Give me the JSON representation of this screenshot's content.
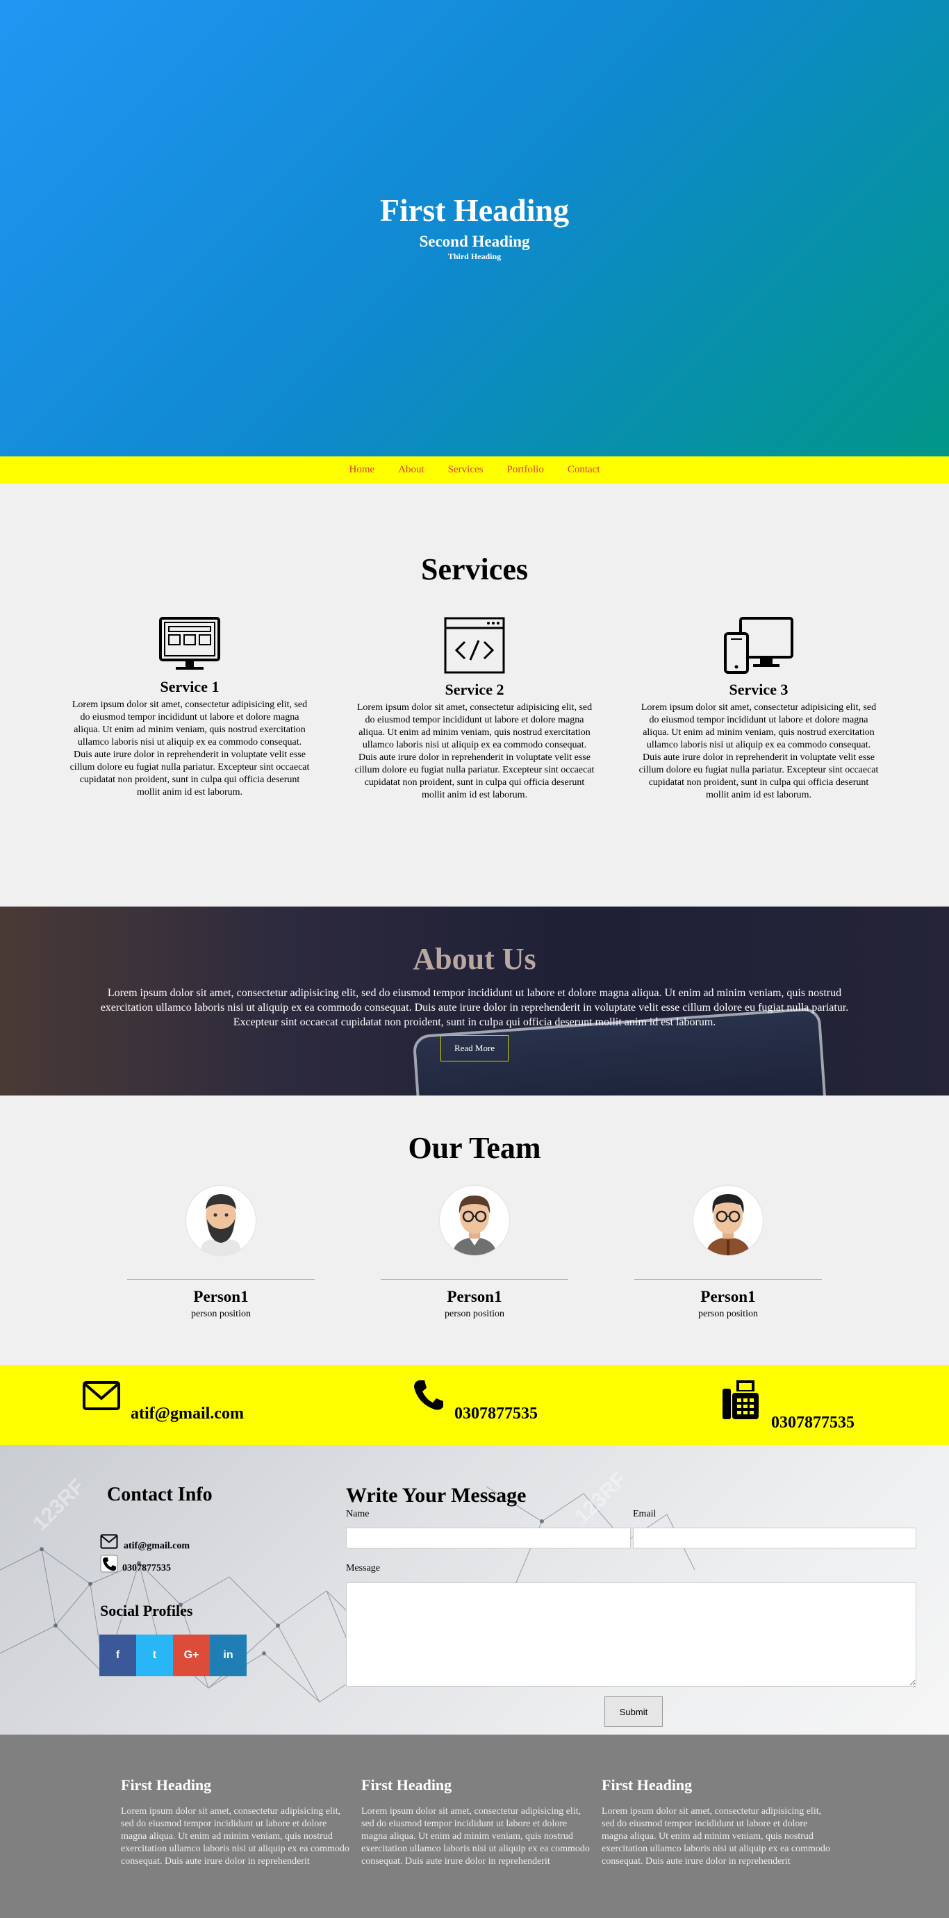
{
  "hero": {
    "heading1": "First Heading",
    "heading2": "Second Heading",
    "heading3": "Third Heading"
  },
  "nav": [
    "Home",
    "About",
    "Services",
    "Portfolio",
    "Contact"
  ],
  "services": {
    "title": "Services",
    "items": [
      {
        "title": "Service 1",
        "icon": "browser-window-icon",
        "text": "Lorem ipsum dolor sit amet, consectetur adipisicing elit, sed do eiusmod tempor incididunt ut labore et dolore magna aliqua. Ut enim ad minim veniam, quis nostrud exercitation ullamco laboris nisi ut aliquip ex ea commodo consequat. Duis aute irure dolor in reprehenderit in voluptate velit esse cillum dolore eu fugiat nulla pariatur. Excepteur sint occaecat cupidatat non proident, sunt in culpa qui officia deserunt mollit anim id est laborum."
      },
      {
        "title": "Service 2",
        "icon": "code-window-icon",
        "text": "Lorem ipsum dolor sit amet, consectetur adipisicing elit, sed do eiusmod tempor incididunt ut labore et dolore magna aliqua. Ut enim ad minim veniam, quis nostrud exercitation ullamco laboris nisi ut aliquip ex ea commodo consequat. Duis aute irure dolor in reprehenderit in voluptate velit esse cillum dolore eu fugiat nulla pariatur. Excepteur sint occaecat cupidatat non proident, sunt in culpa qui officia deserunt mollit anim id est laborum."
      },
      {
        "title": "Service 3",
        "icon": "responsive-devices-icon",
        "text": "Lorem ipsum dolor sit amet, consectetur adipisicing elit, sed do eiusmod tempor incididunt ut labore et dolore magna aliqua. Ut enim ad minim veniam, quis nostrud exercitation ullamco laboris nisi ut aliquip ex ea commodo consequat. Duis aute irure dolor in reprehenderit in voluptate velit esse cillum dolore eu fugiat nulla pariatur. Excepteur sint occaecat cupidatat non proident, sunt in culpa qui officia deserunt mollit anim id est laborum."
      }
    ]
  },
  "about": {
    "title": "About Us",
    "text": "Lorem ipsum dolor sit amet, consectetur adipisicing elit, sed do eiusmod tempor incididunt ut labore et dolore magna aliqua. Ut enim ad minim veniam, quis nostrud exercitation ullamco laboris nisi ut aliquip ex ea commodo consequat. Duis aute irure dolor in reprehenderit in voluptate velit esse cillum dolore eu fugiat nulla pariatur. Excepteur sint occaecat cupidatat non proident, sunt in culpa qui officia deserunt mollit anim id est laborum.",
    "button": "Read More"
  },
  "team": {
    "title": "Our Team",
    "members": [
      {
        "name": "Person1",
        "position": "person position"
      },
      {
        "name": "Person1",
        "position": "person position"
      },
      {
        "name": "Person1",
        "position": "person position"
      }
    ]
  },
  "contact_bar": {
    "email": "atif@gmail.com",
    "phone": "0307877535",
    "fax": "0307877535"
  },
  "contact": {
    "info_title": "Contact Info",
    "email": "atif@gmail.com",
    "phone": "0307877535",
    "social_title": "Social Profiles",
    "social": [
      {
        "label": "f",
        "icon": "facebook-icon",
        "color": "#3b5998"
      },
      {
        "label": "t",
        "icon": "twitter-icon",
        "color": "#29b6f6"
      },
      {
        "label": "G+",
        "icon": "google-plus-icon",
        "color": "#dd4b39"
      },
      {
        "label": "in",
        "icon": "linkedin-icon",
        "color": "#1f7fb5"
      }
    ],
    "form_title": "Write Your Message",
    "name_label": "Name",
    "email_label": "Email",
    "message_label": "Message",
    "submit": "Submit",
    "watermark": "123RF"
  },
  "footer": {
    "columns": [
      {
        "title": "First Heading",
        "text": "Lorem ipsum dolor sit amet, consectetur adipisicing elit, sed do eiusmod tempor incididunt ut labore et dolore magna aliqua. Ut enim ad minim veniam, quis nostrud exercitation ullamco laboris nisi ut aliquip ex ea commodo consequat. Duis aute irure dolor in reprehenderit"
      },
      {
        "title": "First Heading",
        "text": "Lorem ipsum dolor sit amet, consectetur adipisicing elit, sed do eiusmod tempor incididunt ut labore et dolore magna aliqua. Ut enim ad minim veniam, quis nostrud exercitation ullamco laboris nisi ut aliquip ex ea commodo consequat. Duis aute irure dolor in reprehenderit"
      },
      {
        "title": "First Heading",
        "text": "Lorem ipsum dolor sit amet, consectetur adipisicing elit, sed do eiusmod tempor incididunt ut labore et dolore magna aliqua. Ut enim ad minim veniam, quis nostrud exercitation ullamco laboris nisi ut aliquip ex ea commodo consequat. Duis aute irure dolor in reprehenderit"
      }
    ]
  },
  "colors": {
    "nav_bg": "#ffff00",
    "nav_link": "#e53935",
    "footer_bg": "#808080"
  }
}
